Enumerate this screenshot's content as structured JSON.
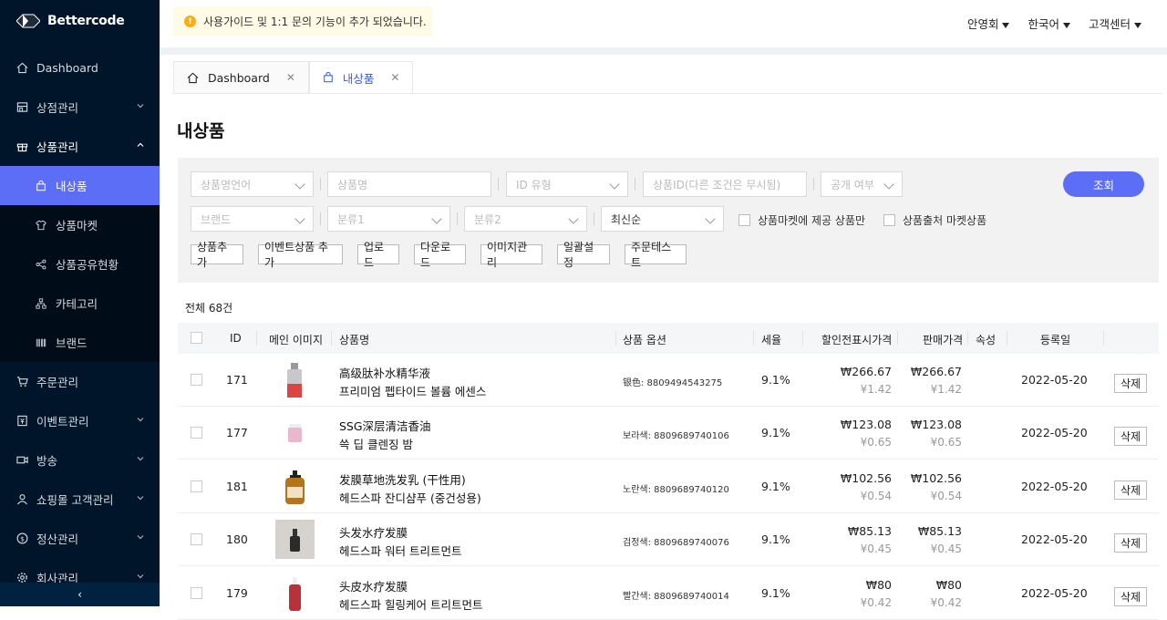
{
  "brand": {
    "name": "Bettercode"
  },
  "sidebar": {
    "items": [
      {
        "label": "Dashboard"
      },
      {
        "label": "상점관리"
      },
      {
        "label": "상품관리"
      },
      {
        "label": "내상품"
      },
      {
        "label": "상품마켓"
      },
      {
        "label": "상품공유현황"
      },
      {
        "label": "카테고리"
      },
      {
        "label": "브랜드"
      },
      {
        "label": "주문관리"
      },
      {
        "label": "이벤트관리"
      },
      {
        "label": "방송"
      },
      {
        "label": "쇼핑몰 고객관리"
      },
      {
        "label": "정산관리"
      },
      {
        "label": "회사관리"
      }
    ],
    "collapse_icon": "‹"
  },
  "notice": {
    "text": "사용가이드 및 1:1 문의 기능이 추가 되었습니다.",
    "icon": "!"
  },
  "top_menu": {
    "user": "안영회",
    "language": "한국어",
    "support": "고객센터"
  },
  "tabs": [
    {
      "label": "Dashboard",
      "close": "✕"
    },
    {
      "label": "내상품",
      "close": "✕"
    }
  ],
  "page": {
    "title": "내상품"
  },
  "filters": {
    "lang": "상품명언어",
    "name": "상품명",
    "id_type": "ID 유형",
    "product_id": "상품ID(다른 조건은 무시됨)",
    "public": "공개 여부",
    "brand": "브랜드",
    "cat1": "분류1",
    "cat2": "분류2",
    "sort": "최신순",
    "check_market": "상품마켓에 제공 상품만",
    "check_export": "상품출처 마켓상품",
    "search_btn": "조회"
  },
  "actions": [
    "상품추가",
    "이벤트상품 추가",
    "업로드",
    "다운로드",
    "이미지관리",
    "일괄설정",
    "주문테스트"
  ],
  "summary": {
    "total": "전체 68건"
  },
  "table": {
    "headers": [
      "ID",
      "메인 이미지",
      "상품명",
      "상품 옵션",
      "세율",
      "할인전표시가격",
      "판매가격",
      "속성",
      "등록일"
    ],
    "delete_label": "삭제",
    "rows": [
      {
        "id": "171",
        "name_cn": "高级肽补水精华液",
        "name_kr": "프리미엄 펩타이드 볼륨 에센스",
        "option": "银色: 8809494543275",
        "rate": "9.1%",
        "list_price": "₩266.67",
        "list_price_sub": "¥1.42",
        "price": "₩266.67",
        "price_sub": "¥1.42",
        "date": "2022-05-20",
        "img": "silver-bottle"
      },
      {
        "id": "177",
        "name_cn": "SSG深层清洁香油",
        "name_kr": "쓱 딥 클렌징 밤",
        "option": "보라색: 8809689740106",
        "rate": "9.1%",
        "list_price": "₩123.08",
        "list_price_sub": "¥0.65",
        "price": "₩123.08",
        "price_sub": "¥0.65",
        "date": "2022-05-20",
        "img": "pink-jar"
      },
      {
        "id": "181",
        "name_cn": "发膜草地洗发乳 (干性用)",
        "name_kr": "헤드스파 잔디샴푸 (중건성용)",
        "option": "노란색: 8809689740120",
        "rate": "9.1%",
        "list_price": "₩102.56",
        "list_price_sub": "¥0.54",
        "price": "₩102.56",
        "price_sub": "¥0.54",
        "date": "2022-05-20",
        "img": "amber-pump"
      },
      {
        "id": "180",
        "name_cn": "头发水疗发膜",
        "name_kr": "헤드스파 워터 트리트먼트",
        "option": "검정색: 8809689740076",
        "rate": "9.1%",
        "list_price": "₩85.13",
        "list_price_sub": "¥0.45",
        "price": "₩85.13",
        "price_sub": "¥0.45",
        "date": "2022-05-20",
        "img": "dark-bottle"
      },
      {
        "id": "179",
        "name_cn": "头皮水疗发膜",
        "name_kr": "헤드스파 힐링케어 트리트먼트",
        "option": "빨간색: 8809689740014",
        "rate": "9.1%",
        "list_price": "₩80",
        "list_price_sub": "¥0.42",
        "price": "₩80",
        "price_sub": "¥0.42",
        "date": "2022-05-20",
        "img": "red-bottle"
      }
    ]
  },
  "colors": {
    "sidebar_bg": "#001529",
    "accent": "#5b6ef5",
    "notice_bg": "#fffbe6"
  }
}
